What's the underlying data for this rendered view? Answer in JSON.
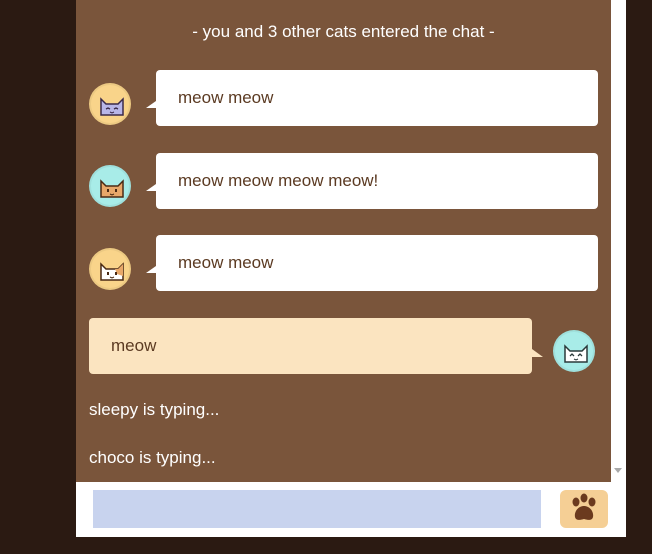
{
  "system_message": "- you and 3 other cats entered the chat -",
  "messages": [
    {
      "text": "meow meow",
      "avatar_bg": "#f9d48a",
      "cat_color": "#b8b6e8",
      "icon": "purple-cat-icon"
    },
    {
      "text": "meow meow meow meow!",
      "avatar_bg": "#a8ece8",
      "cat_color": "#e8a86a",
      "icon": "orange-cat-icon"
    },
    {
      "text": "meow meow",
      "avatar_bg": "#f9d48a",
      "cat_color": "#ffffff",
      "icon": "calico-cat-icon"
    },
    {
      "text": "meow",
      "avatar_bg": "#a8ece8",
      "cat_color": "#ffffff",
      "icon": "white-cat-icon"
    }
  ],
  "typing": [
    "sleepy is typing...",
    "choco is typing..."
  ],
  "input": {
    "placeholder": ""
  },
  "send": {
    "icon": "paw-icon",
    "color": "#6b3a1e"
  },
  "colors": {
    "chat_bg": "#7a553b",
    "page_bg": "#2b1a12",
    "own_bubble": "#fbe4c0",
    "input_bg": "#c8d3ee"
  }
}
